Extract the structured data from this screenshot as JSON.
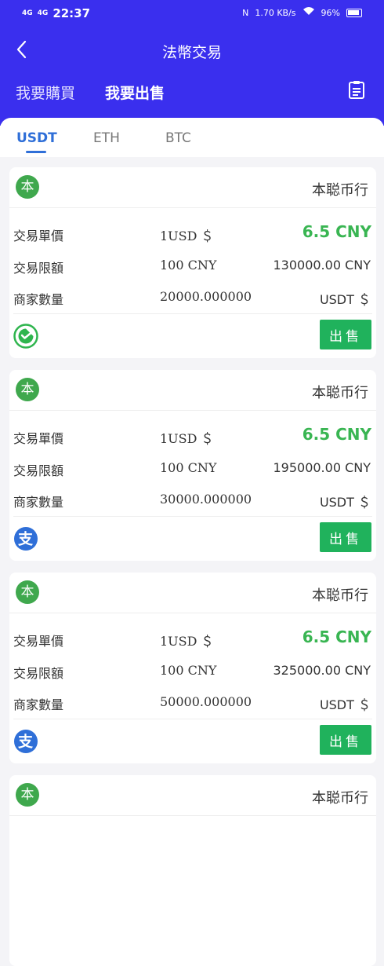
{
  "status": {
    "sig1": "4G",
    "sig2": "4G",
    "time": "22:37",
    "nfc": "N",
    "speed": "1.70",
    "speed_unit": "KB/s",
    "battery": "96%"
  },
  "header": {
    "title": "法幣交易",
    "tabs": [
      {
        "label": "我要購買"
      },
      {
        "label": "我要出售"
      }
    ],
    "active_tab": "我要出售"
  },
  "coins": [
    {
      "label": "USDT"
    },
    {
      "label": "ETH"
    },
    {
      "label": "BTC"
    }
  ],
  "active_coin": "USDT",
  "labels": {
    "price": "交易單價",
    "limit": "交易限額",
    "quantity": "商家數量"
  },
  "listings": [
    {
      "merchant_badge": "本",
      "merchant": "本聪币行",
      "unit": "1USD ＄",
      "price": "6.5 CNY",
      "limit_min": "100 CNY",
      "limit_max": "130000.00 CNY",
      "quantity": "20000.000000",
      "quantity_unit": "USDT ＄",
      "payment_icon": "wechat-pay-icon",
      "action": "出售"
    },
    {
      "merchant_badge": "本",
      "merchant": "本聪币行",
      "unit": "1USD ＄",
      "price": "6.5 CNY",
      "limit_min": "100 CNY",
      "limit_max": "195000.00 CNY",
      "quantity": "30000.000000",
      "quantity_unit": "USDT ＄",
      "payment_icon": "alipay-icon",
      "action": "出售"
    },
    {
      "merchant_badge": "本",
      "merchant": "本聪币行",
      "unit": "1USD ＄",
      "price": "6.5 CNY",
      "limit_min": "100 CNY",
      "limit_max": "325000.00 CNY",
      "quantity": "50000.000000",
      "quantity_unit": "USDT ＄",
      "payment_icon": "alipay-icon",
      "action": "出售"
    },
    {
      "merchant_badge": "本",
      "merchant": "本聪币行"
    }
  ],
  "colors": {
    "header_bg": "#3a2fee",
    "active_coin": "#2f6fd8",
    "price": "#39b552",
    "sell_button": "#20b25c",
    "merchant_badge": "#3fa84d",
    "alipay": "#2f6fd8",
    "wechat": "#2fb54e"
  }
}
